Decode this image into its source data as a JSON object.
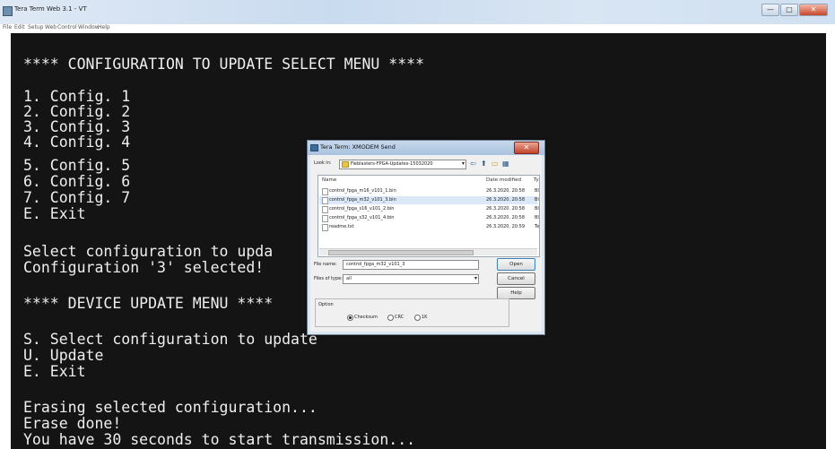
{
  "window": {
    "title": "Tera Term Web 3.1 - VT",
    "menu": [
      "File",
      "Edit",
      "Setup",
      "Web",
      "Control",
      "Window",
      "Help"
    ],
    "buttons": {
      "minimize": "—",
      "maximize": "□",
      "close": "✕"
    }
  },
  "terminal": {
    "lines": [
      "**** CONFIGURATION TO UPDATE SELECT MENU ****",
      "1. Config. 1",
      "2. Config. 2",
      "3. Config. 3",
      "4. Config. 4",
      "5. Config. 5",
      "6. Config. 6",
      "7. Config. 7",
      "E. Exit",
      "Select configuration to upda",
      "Configuration '3' selected!",
      "**** DEVICE UPDATE MENU ****",
      "S. Select configuration to update",
      "U. Update",
      "E. Exit",
      "Erasing selected configuration...",
      "Erase done!",
      "You have 30 seconds to start transmission..."
    ]
  },
  "dialog": {
    "title": "Tera Term: XMODEM Send",
    "close": "✕",
    "look_in_label": "Look in:",
    "look_in_value": "Fieblasters-FPGA-Updates-15032020",
    "columns": {
      "name": "Name",
      "date": "Date modified",
      "type": "Ty"
    },
    "files": [
      {
        "name": "control_fpga_m16_v101_1.bin",
        "date": "26.3.2020. 20:58",
        "type": "BI"
      },
      {
        "name": "control_fpga_m32_v101_3.bin",
        "date": "26.3.2020. 20:58",
        "type": "BI"
      },
      {
        "name": "control_fpga_s16_v101_2.bin",
        "date": "26.3.2020. 20:58",
        "type": "BI"
      },
      {
        "name": "control_fpga_s32_v101_4.bin",
        "date": "26.3.2020. 20:58",
        "type": "BI"
      },
      {
        "name": "readme.txt",
        "date": "26.3.2020. 20:59",
        "type": "Te"
      }
    ],
    "file_name_label": "File name:",
    "file_name_value": "control_fpga_m32_v101_3",
    "files_of_type_label": "Files of type:",
    "files_of_type_value": "all",
    "buttons": {
      "open": "Open",
      "cancel": "Cancel",
      "help": "Help"
    },
    "option_label": "Option",
    "options": [
      {
        "label": "Checksum",
        "selected": true
      },
      {
        "label": "CRC",
        "selected": false
      },
      {
        "label": "1K",
        "selected": false
      }
    ]
  }
}
